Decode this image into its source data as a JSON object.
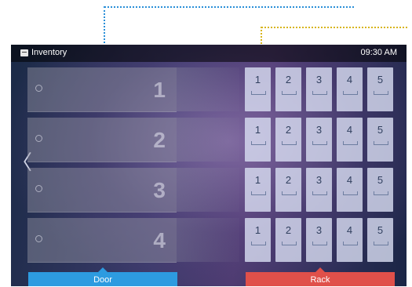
{
  "status_bar": {
    "title": "Inventory",
    "icon": "inventory-icon",
    "time": "09:30 AM"
  },
  "doors": [
    {
      "number": "1"
    },
    {
      "number": "2"
    },
    {
      "number": "3"
    },
    {
      "number": "4"
    }
  ],
  "rack": {
    "rows": [
      [
        "1",
        "2",
        "3",
        "4",
        "5"
      ],
      [
        "1",
        "2",
        "3",
        "4",
        "5"
      ],
      [
        "1",
        "2",
        "3",
        "4",
        "5"
      ],
      [
        "1",
        "2",
        "3",
        "4",
        "5"
      ]
    ]
  },
  "tabs": {
    "door_label": "Door",
    "rack_label": "Rack"
  },
  "colors": {
    "door_tab": "#2d9be0",
    "rack_tab": "#e0504a",
    "door_annotation": "#2a8fd8",
    "rack_annotation": "#e8cf1e"
  }
}
